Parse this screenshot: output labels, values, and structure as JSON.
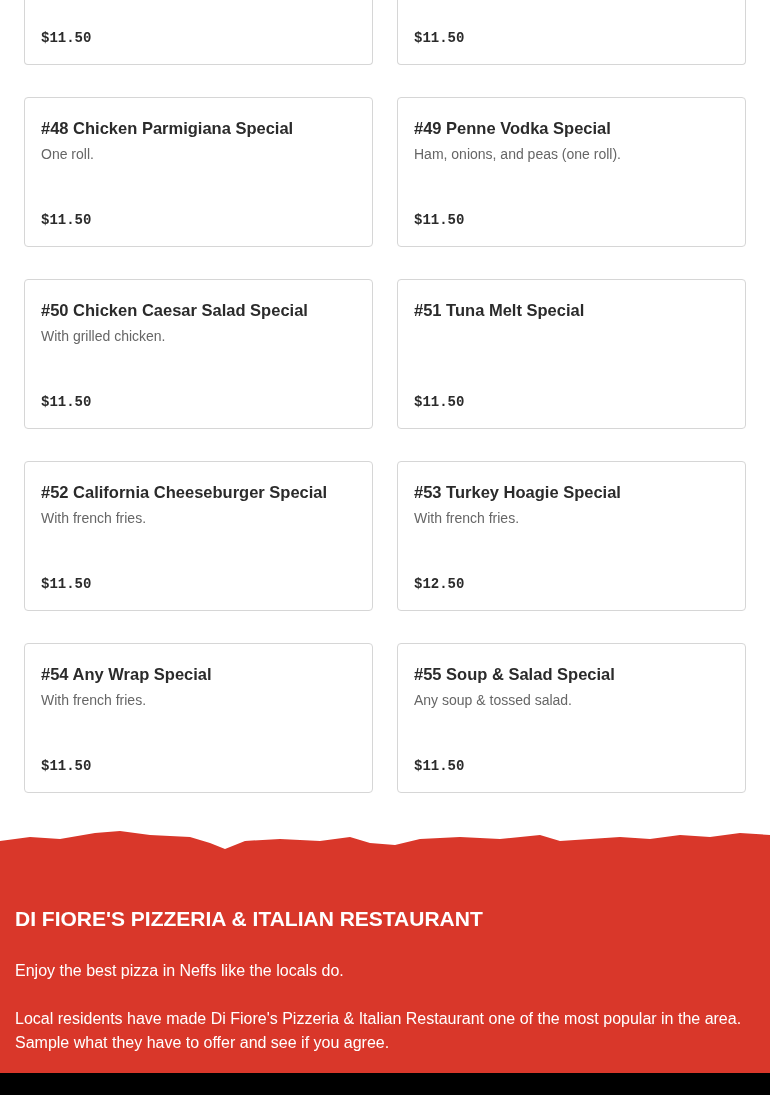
{
  "menu_items": [
    {
      "price": "$11.50"
    },
    {
      "price": "$11.50"
    },
    {
      "name": "#48 Chicken Parmigiana Special",
      "description": "One roll.",
      "price": "$11.50"
    },
    {
      "name": "#49 Penne Vodka Special",
      "description": "Ham, onions, and peas (one roll).",
      "price": "$11.50"
    },
    {
      "name": "#50 Chicken Caesar Salad Special",
      "description": "With grilled chicken.",
      "price": "$11.50"
    },
    {
      "name": "#51 Tuna Melt Special",
      "price": "$11.50"
    },
    {
      "name": "#52 California Cheeseburger Special",
      "description": "With french fries.",
      "price": "$11.50"
    },
    {
      "name": "#53 Turkey Hoagie Special",
      "description": "With french fries.",
      "price": "$12.50"
    },
    {
      "name": "#54 Any Wrap Special",
      "description": "With french fries.",
      "price": "$11.50"
    },
    {
      "name": "#55 Soup & Salad Special",
      "description": "Any soup & tossed salad.",
      "price": "$11.50"
    }
  ],
  "footer": {
    "title": "DI FIORE'S PIZZERIA & ITALIAN RESTAURANT",
    "paragraphs": [
      "Enjoy the best pizza in Neffs like the locals do.",
      "Local residents have made Di Fiore's Pizzeria & Italian Restaurant one of the most popular in the area. Sample what they have to offer and see if you agree."
    ]
  }
}
